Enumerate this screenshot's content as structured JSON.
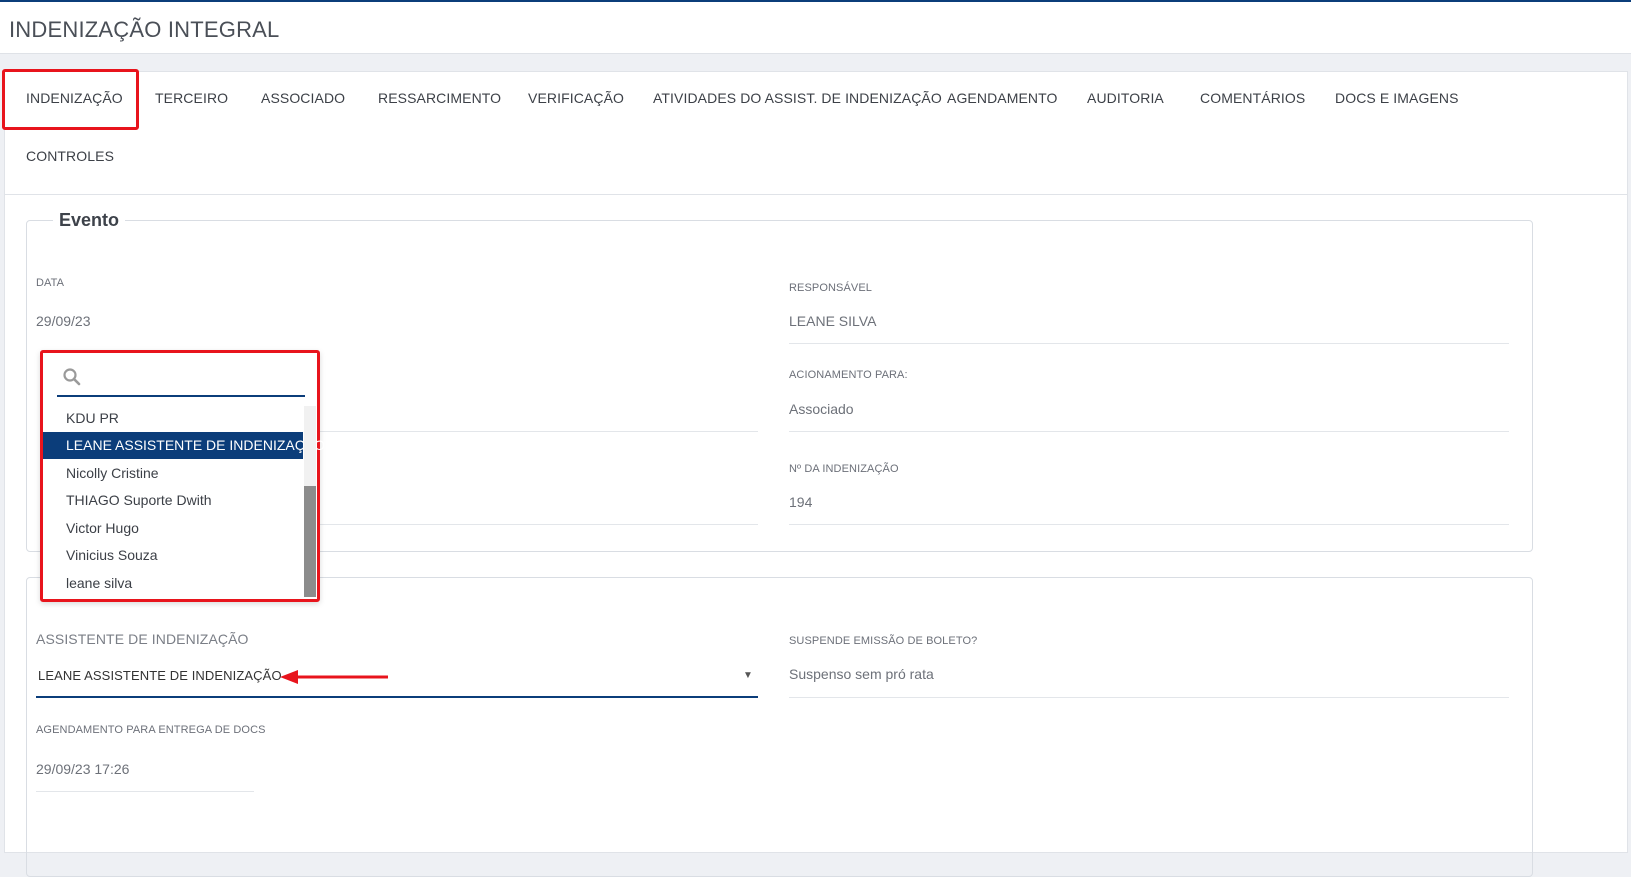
{
  "page": {
    "title": "INDENIZAÇÃO INTEGRAL"
  },
  "tabs": [
    {
      "label": "INDENIZAÇÃO"
    },
    {
      "label": "TERCEIRO"
    },
    {
      "label": "ASSOCIADO"
    },
    {
      "label": "RESSARCIMENTO"
    },
    {
      "label": "VERIFICAÇÃO"
    },
    {
      "label": "ATIVIDADES DO ASSIST. DE INDENIZAÇÃO"
    },
    {
      "label": "AGENDAMENTO"
    },
    {
      "label": "AUDITORIA"
    },
    {
      "label": "COMENTÁRIOS"
    },
    {
      "label": "DOCS E IMAGENS"
    },
    {
      "label": "CONTROLES"
    }
  ],
  "evento": {
    "legend": "Evento",
    "data_label": "DATA",
    "data_value": "29/09/23",
    "responsavel_label": "RESPONSÁVEL",
    "responsavel_value": "LEANE SILVA",
    "acionamento_label": "ACIONAMENTO PARA:",
    "acionamento_value": "Associado",
    "numero_label": "Nº DA INDENIZAÇÃO",
    "numero_value": "194"
  },
  "assistente": {
    "label": "ASSISTENTE DE INDENIZAÇÃO",
    "selected_value": "LEANE ASSISTENTE DE INDENIZAÇÃO",
    "caret": "▼",
    "suspende_label": "SUSPENDE EMISSÃO DE BOLETO?",
    "suspende_value": "Suspenso sem pró rata",
    "agendamento_label": "AGENDAMENTO PARA ENTREGA DE DOCS",
    "agendamento_value": "29/09/23 17:26"
  },
  "dropdown": {
    "search_value": "",
    "options": [
      {
        "label": "KDU PR"
      },
      {
        "label": "LEANE ASSISTENTE DE INDENIZAÇÃO"
      },
      {
        "label": "Nicolly Cristine"
      },
      {
        "label": "THIAGO Suporte Dwith"
      },
      {
        "label": "Victor Hugo"
      },
      {
        "label": "Vinicius Souza"
      },
      {
        "label": "leane silva"
      }
    ],
    "selected_index": 1
  },
  "colors": {
    "accent": "#0b3d7a",
    "highlight": "#e8141c"
  },
  "icons": {
    "search": "search-icon",
    "caret": "chevron-down-icon",
    "arrow": "arrow-left-annotation"
  }
}
